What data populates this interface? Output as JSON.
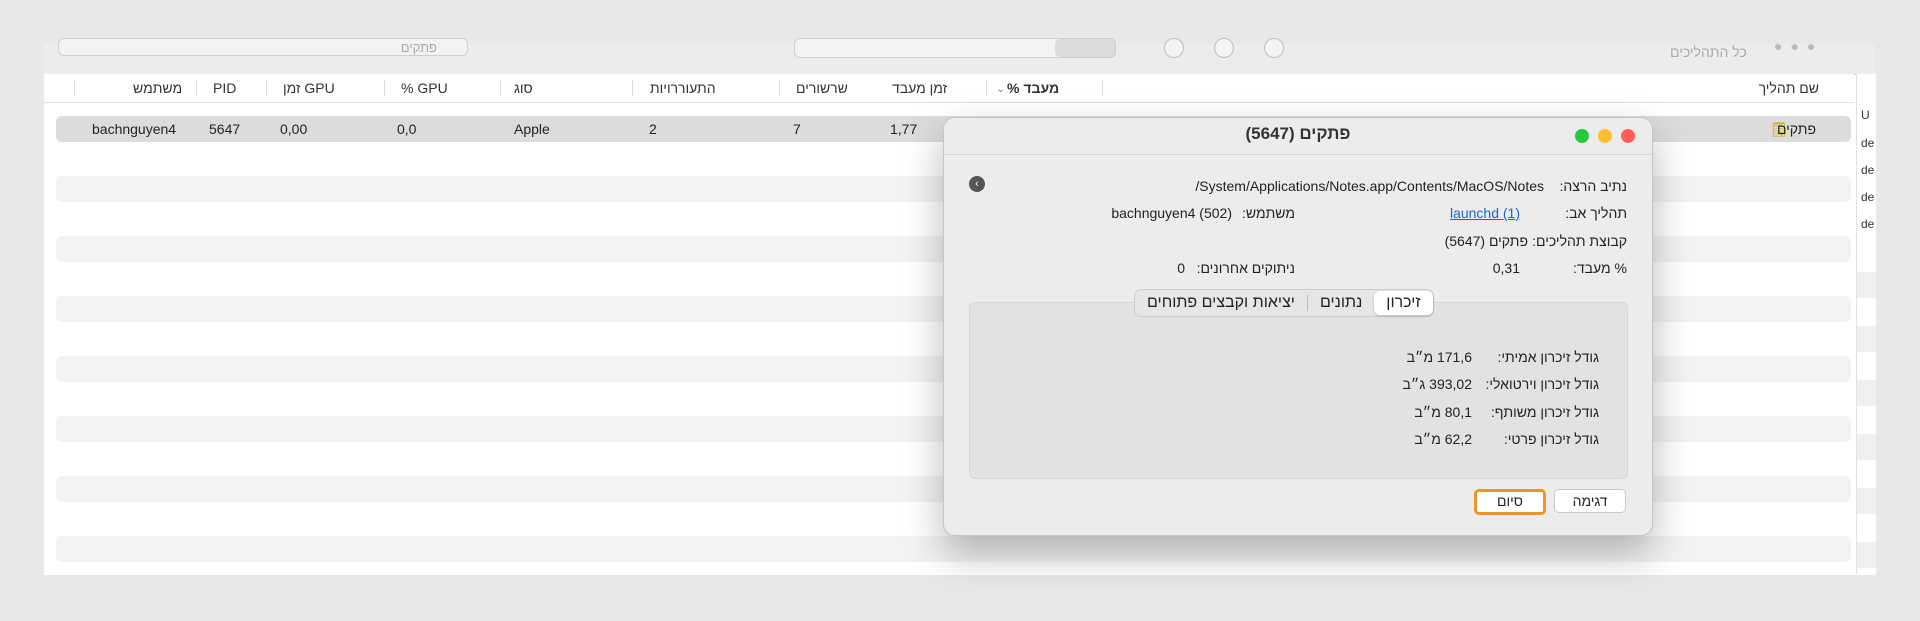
{
  "toolbar": {
    "search_placeholder": "פתקים",
    "window_title": "כל התהליכים"
  },
  "columns": {
    "process_name": "שם תהליך",
    "cpu_pct": "% מעבד",
    "cpu_time": "זמן מעבד",
    "threads": "שרשורים",
    "wakeups": "התעוררויות",
    "kind": "סוג",
    "gpu_pct": "% GPU",
    "gpu_time": "זמן GPU",
    "pid": "PID",
    "user": "משתמש"
  },
  "row": {
    "name": "פתקים",
    "cpu_time": "1,77",
    "threads": "7",
    "wakeups": "2",
    "kind": "Apple",
    "gpu_pct": "0,0",
    "gpu_time": "0,00",
    "pid": "5647",
    "user": "bachnguyen4"
  },
  "right_strip": [
    "U",
    "de",
    "de",
    "de",
    "de"
  ],
  "dialog": {
    "title": "פתקים (5647)",
    "exec_path_label": "נתיב הרצה:",
    "exec_path_value": "/System/Applications/Notes.app/Contents/MacOS/Notes",
    "parent_label": "תהליך אב:",
    "parent_value": "launchd (1)",
    "user_label": "משתמש:",
    "user_value": "bachnguyen4 (502)",
    "group_label": "קבוצת תהליכים:",
    "group_value": "פתקים (5647)",
    "cpu_label": "% מעבד:",
    "cpu_value": "0,31",
    "crashes_label": "ניתוקים אחרונים:",
    "crashes_value": "0",
    "tabs": {
      "memory": "זיכרון",
      "stats": "נתונים",
      "ports": "יציאות וקבצים פתוחים"
    },
    "memory": {
      "real_label": "גודל זיכרון אמיתי:",
      "real_value": "171,6 מ״ב",
      "virtual_label": "גודל זיכרון וירטואלי:",
      "virtual_value": "393,02 ג״ב",
      "shared_label": "גודל זיכרון משותף:",
      "shared_value": "80,1 מ״ב",
      "private_label": "גודל זיכרון פרטי:",
      "private_value": "62,2 מ״ב"
    },
    "sample_button": "דגימה",
    "done_button": "סיום"
  },
  "colors": {
    "close": "#ff5f57",
    "minimize": "#febc2e",
    "zoom": "#28c840",
    "focus_ring": "#f0932b",
    "link": "#1a66d0"
  }
}
